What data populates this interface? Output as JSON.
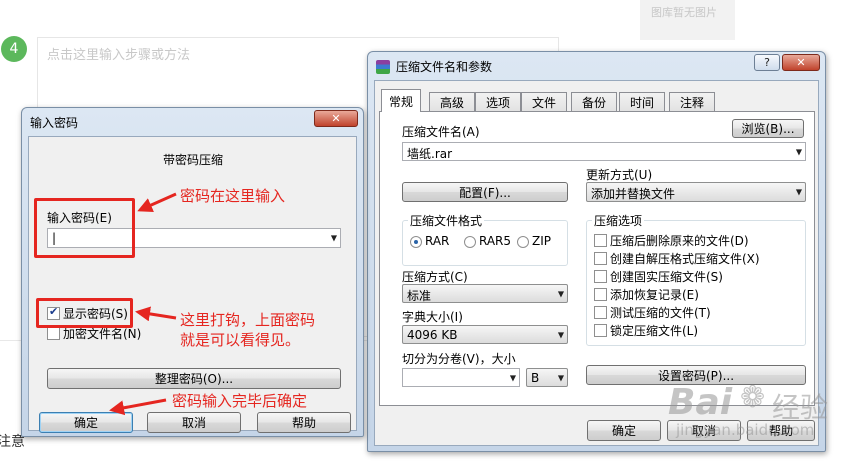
{
  "background": {
    "step_number": "4",
    "step_placeholder": "点击这里输入步骤或方法",
    "no_image": "图库暂无图片",
    "note_fragment": "注意"
  },
  "password_dialog": {
    "title": "输入密码",
    "close_glyph": "✕",
    "heading": "带密码压缩",
    "password_label": "输入密码(E)",
    "password_value": "|",
    "dropdown_glyph": "▼",
    "show_password_label": "显示密码(S)",
    "show_password_checked": true,
    "encrypt_names_label": "加密文件名(N)",
    "encrypt_names_checked": false,
    "organize_button": "整理密码(O)...",
    "ok_button": "确定",
    "cancel_button": "取消",
    "help_button": "帮助"
  },
  "archive_dialog": {
    "title": "压缩文件名和参数",
    "help_glyph": "?",
    "close_glyph": "✕",
    "tabs": [
      {
        "label": "常规",
        "active": true
      },
      {
        "label": "高级",
        "active": false
      },
      {
        "label": "选项",
        "active": false
      },
      {
        "label": "文件",
        "active": false
      },
      {
        "label": "备份",
        "active": false
      },
      {
        "label": "时间",
        "active": false
      },
      {
        "label": "注释",
        "active": false
      }
    ],
    "archive_name_label": "压缩文件名(A)",
    "browse_button": "浏览(B)...",
    "archive_name_value": "墙纸.rar",
    "update_mode_label": "更新方式(U)",
    "update_mode_value": "添加并替换文件",
    "profile_button": "配置(F)...",
    "format_group_title": "压缩文件格式",
    "formats": [
      {
        "label": "RAR",
        "checked": true
      },
      {
        "label": "RAR5",
        "checked": false
      },
      {
        "label": "ZIP",
        "checked": false
      }
    ],
    "options_group_title": "压缩选项",
    "options": [
      {
        "label": "压缩后删除原来的文件(D)",
        "checked": false
      },
      {
        "label": "创建自解压格式压缩文件(X)",
        "checked": false
      },
      {
        "label": "创建固实压缩文件(S)",
        "checked": false
      },
      {
        "label": "添加恢复记录(E)",
        "checked": false
      },
      {
        "label": "测试压缩的文件(T)",
        "checked": false
      },
      {
        "label": "锁定压缩文件(L)",
        "checked": false
      }
    ],
    "method_label": "压缩方式(C)",
    "method_value": "标准",
    "dict_label": "字典大小(I)",
    "dict_value": "4096 KB",
    "split_label": "切分为分卷(V)，大小",
    "split_value": "",
    "split_unit": "B",
    "set_password_button": "设置密码(P)...",
    "ok_button": "确定",
    "cancel_button": "取消",
    "help_button": "帮助"
  },
  "annotations": {
    "enter_here": "密码在这里输入",
    "check_line1": "这里打钩，上面密码",
    "check_line2": "就是可以看得见。",
    "confirm": "密码输入完毕后确定",
    "color": "#e52620"
  },
  "watermark": {
    "brand": "Bai",
    "brand2": "经验",
    "url": "jingyan.baidu.com"
  }
}
